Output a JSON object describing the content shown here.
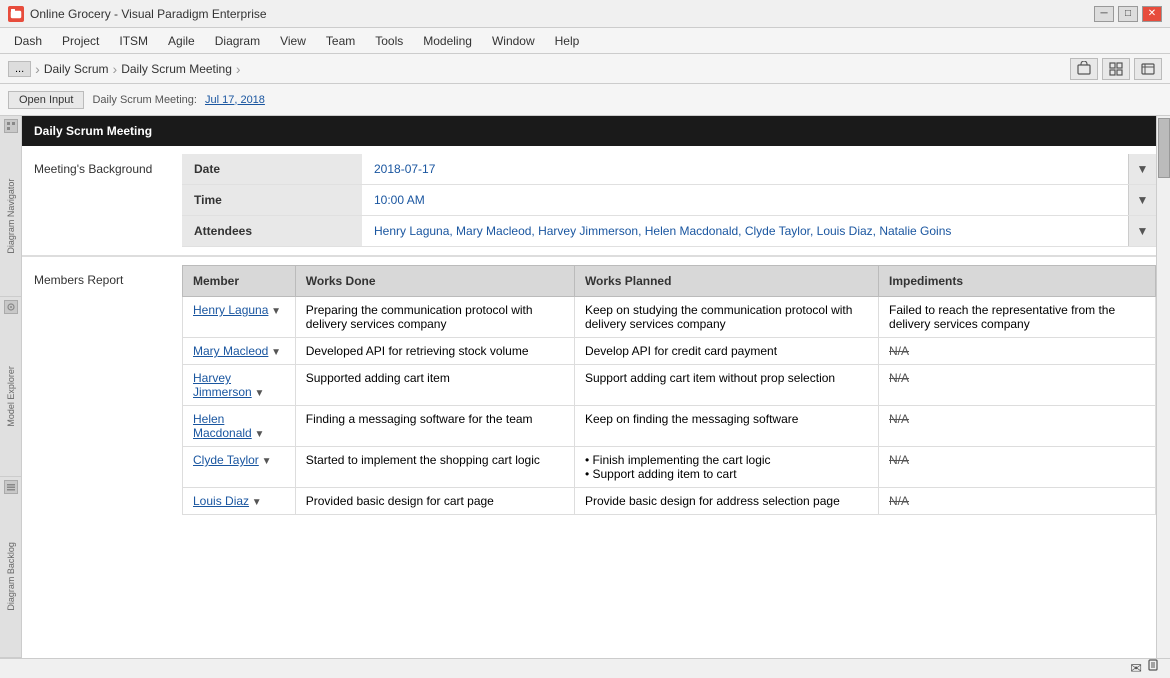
{
  "titleBar": {
    "appName": "Online Grocery - Visual Paradigm Enterprise",
    "minBtn": "─",
    "maxBtn": "□",
    "closeBtn": "✕"
  },
  "menuBar": {
    "items": [
      "Dash",
      "Project",
      "ITSM",
      "Agile",
      "Diagram",
      "View",
      "Team",
      "Tools",
      "Modeling",
      "Window",
      "Help"
    ]
  },
  "breadcrumb": {
    "dots": "...",
    "items": [
      "Daily Scrum",
      "Daily Scrum Meeting"
    ]
  },
  "toolbar": {
    "openInputLabel": "Open Input",
    "dailyScrumLabel": "Daily Scrum Meeting:",
    "dateValue": "Jul 17, 2018"
  },
  "sectionHeader": {
    "title": "Daily Scrum Meeting"
  },
  "meetingsBackground": {
    "label": "Meeting's Background",
    "fields": [
      {
        "label": "Date",
        "value": "2018-07-17"
      },
      {
        "label": "Time",
        "value": "10:00 AM"
      },
      {
        "label": "Attendees",
        "value": "Henry Laguna, Mary Macleod, Harvey Jimmerson, Helen Macdonald, Clyde Taylor, Louis Diaz, Natalie Goins"
      }
    ]
  },
  "membersReport": {
    "label": "Members Report",
    "columns": [
      "Member",
      "Works Done",
      "Works Planned",
      "Impediments"
    ],
    "rows": [
      {
        "member": "Henry Laguna",
        "worksDone": "Preparing the communication protocol with delivery services company",
        "worksPlanned": "Keep on studying the communication protocol with delivery services company",
        "impediments": "Failed to reach the representative from the delivery services company"
      },
      {
        "member": "Mary Macleod",
        "worksDone": "Developed API for retrieving stock volume",
        "worksPlanned": "Develop API for credit card payment",
        "impediments": "N/A"
      },
      {
        "member": "Harvey Jimmerson",
        "worksDone": "Supported adding cart item",
        "worksPlanned": "Support adding cart item without prop selection",
        "impediments": "N/A"
      },
      {
        "member": "Helen Macdonald",
        "worksDone": "Finding a messaging software for the team",
        "worksPlanned": "Keep on finding the messaging software",
        "impediments": "N/A"
      },
      {
        "member": "Clyde Taylor",
        "worksDone": "Started to implement the shopping cart logic",
        "worksPlanned": "• Finish implementing the cart logic\n• Support adding item to cart",
        "impediments": "N/A"
      },
      {
        "member": "Louis Diaz",
        "worksDone": "Provided basic design for cart page",
        "worksPlanned": "Provide basic design for address selection page",
        "impediments": "N/A"
      }
    ]
  },
  "leftNav": {
    "sections": [
      "Diagram Navigator",
      "Model Explorer",
      "Diagram Backlog"
    ]
  },
  "statusBar": {
    "emailIcon": "✉",
    "docIcon": "📄"
  }
}
